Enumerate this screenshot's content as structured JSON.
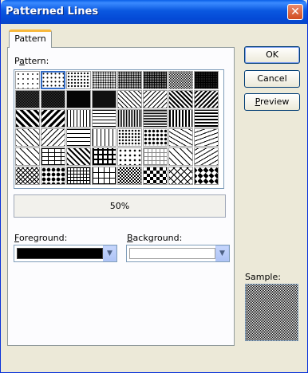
{
  "window": {
    "title": "Patterned Lines",
    "close_glyph": "✕"
  },
  "tabs": [
    {
      "label": "Pattern",
      "active": true
    }
  ],
  "pattern_label_prefix": "P",
  "pattern_label_mnemonic": "a",
  "pattern_label_rest": "ttern:",
  "pattern_grid": {
    "selected_index": 1,
    "names": [
      "5%",
      "10%",
      "20%",
      "25%",
      "30%",
      "40%",
      "50%",
      "60%",
      "70%",
      "75%",
      "80%",
      "90%",
      "light-downward-diagonal",
      "light-upward-diagonal",
      "dark-downward-diagonal",
      "dark-upward-diagonal",
      "wide-downward-diagonal",
      "wide-upward-diagonal",
      "light-vertical",
      "light-horizontal",
      "narrow-vertical",
      "narrow-horizontal",
      "dark-vertical",
      "dark-horizontal",
      "dashed-downward-diagonal",
      "dashed-upward-diagonal",
      "dashed-horizontal",
      "dashed-vertical",
      "small-confetti",
      "large-confetti",
      "zig-zag",
      "wave",
      "diagonal-brick",
      "horizontal-brick",
      "weave",
      "plaid",
      "divot",
      "dotted-grid",
      "dotted-diamond",
      "shingle",
      "trellis",
      "sphere",
      "small-grid",
      "large-grid",
      "small-checkerboard",
      "large-checkerboard",
      "outlined-diamond",
      "solid-diamond"
    ]
  },
  "selected_pattern_text": "50%",
  "foreground": {
    "label_mnemonic": "F",
    "label_rest": "oreground:",
    "color": "#000000"
  },
  "background": {
    "label_mnemonic": "B",
    "label_rest": "ackground:",
    "color": "#ffffff"
  },
  "buttons": {
    "ok": "OK",
    "cancel": "Cancel",
    "preview_mnemonic": "P",
    "preview_rest": "review"
  },
  "sample_label": "Sample:",
  "sample_pattern": "50%",
  "dropdown_glyph": "▼"
}
